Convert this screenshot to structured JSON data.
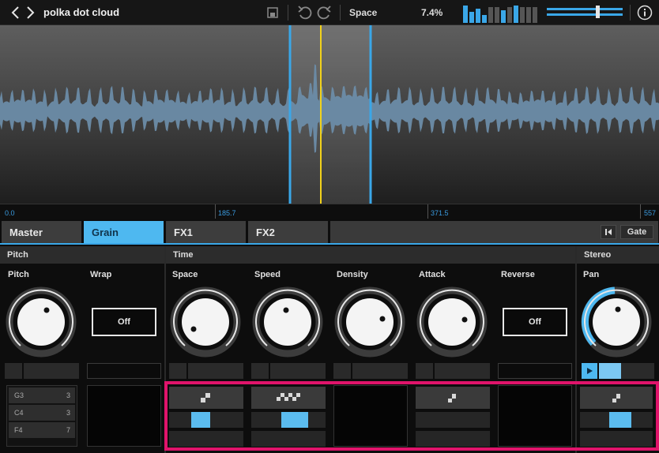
{
  "header": {
    "title": "polka dot cloud",
    "param_name": "Space",
    "param_value": "7.4%",
    "icons": [
      "back-icon",
      "forward-icon",
      "save-icon",
      "undo-icon",
      "redo-icon",
      "info-icon"
    ]
  },
  "waveform": {
    "ruler_labels": [
      "0.0",
      "185.7",
      "371.5",
      "557"
    ],
    "colors": {
      "wave": "#6b8ca8",
      "selection_edge": "#3aa7e8",
      "playhead": "#f2d21b"
    }
  },
  "tabs": [
    "Master",
    "Grain",
    "FX1",
    "FX2"
  ],
  "active_tab": "Grain",
  "toolbar": {
    "gate_label": "Gate",
    "first_icon": "skip-start-icon"
  },
  "sections": {
    "pitch": "Pitch",
    "time": "Time",
    "stereo": "Stereo"
  },
  "params": {
    "pitch": "Pitch",
    "wrap": "Wrap",
    "space": "Space",
    "speed": "Speed",
    "density": "Density",
    "attack": "Attack",
    "reverse": "Reverse",
    "pan": "Pan"
  },
  "toggles": {
    "wrap": "Off",
    "reverse": "Off"
  },
  "notes": [
    {
      "name": "G3",
      "count": "3"
    },
    {
      "name": "C4",
      "count": "3"
    },
    {
      "name": "F4",
      "count": "7"
    }
  ],
  "modulation": {
    "space_level": 0.25,
    "speed_level": 0.4,
    "pan_level": 0.4,
    "pan_fill": 0.4
  },
  "colors": {
    "accent": "#4eb8f0",
    "highlight": "#e0146b"
  }
}
